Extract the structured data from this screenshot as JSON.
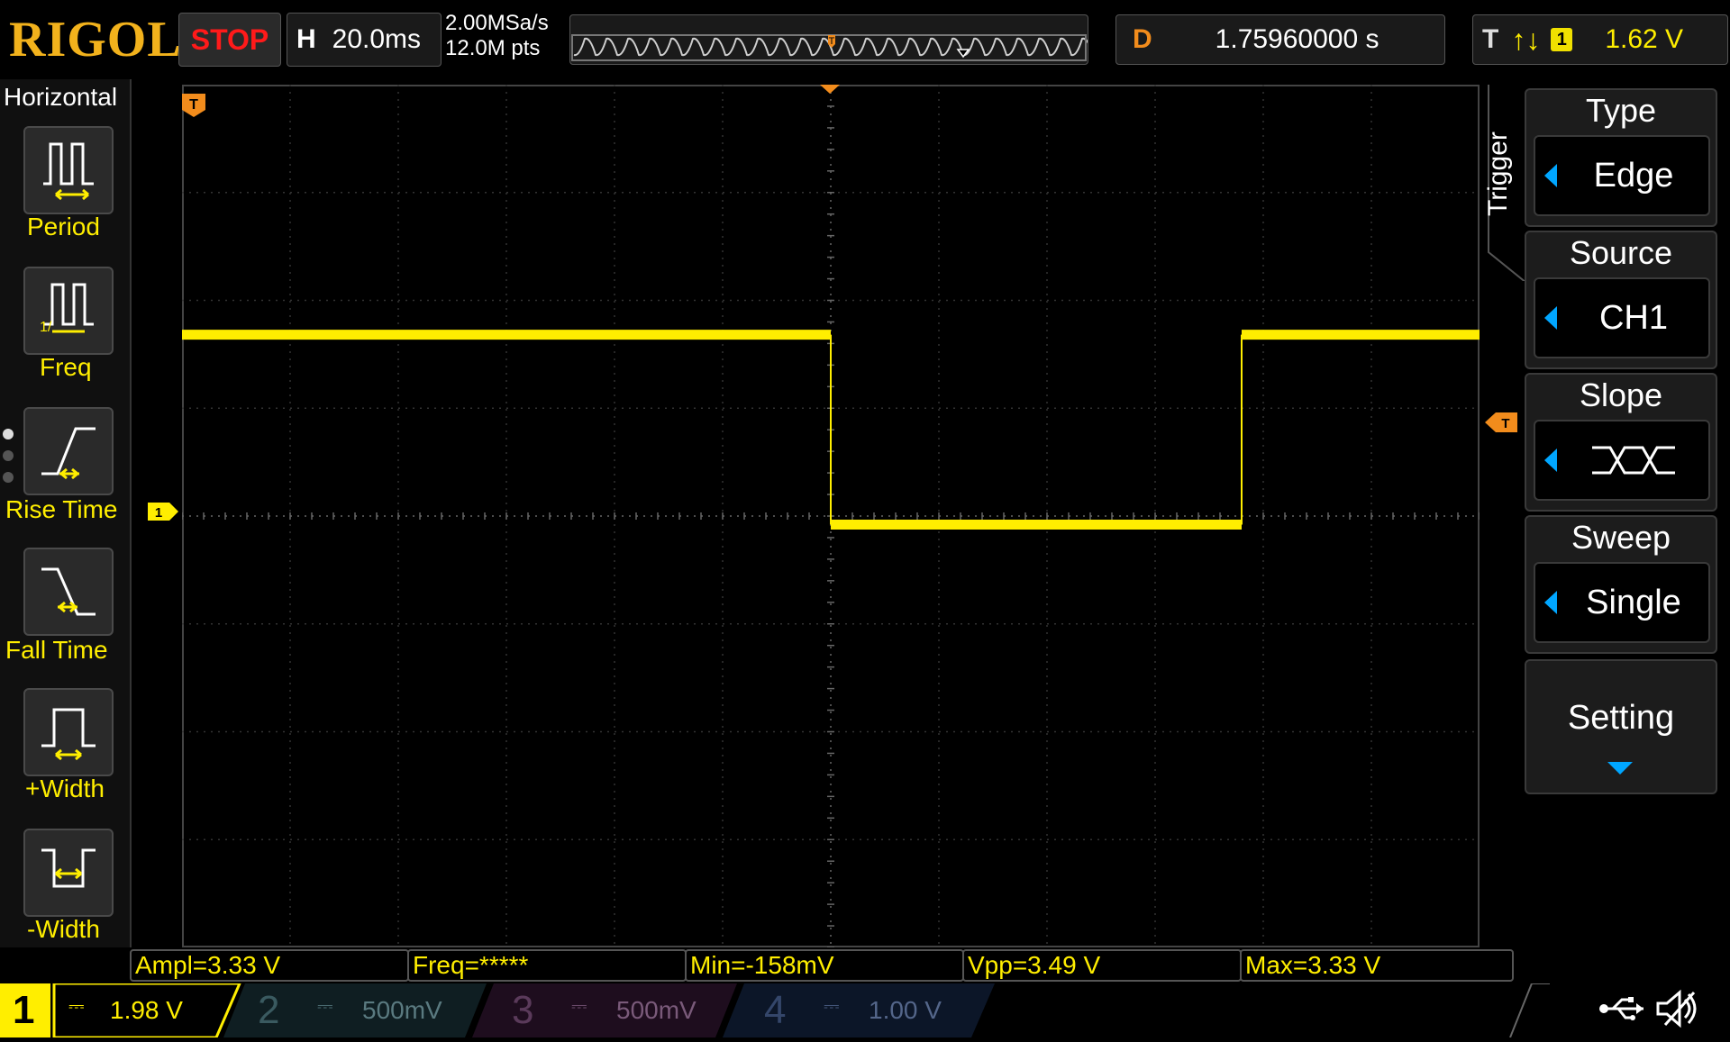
{
  "header": {
    "brand": "RIGOL",
    "run_state": "STOP",
    "timebase_letter": "H",
    "timebase_value": "20.0ms",
    "sample_rate": "2.00MSa/s",
    "memory_depth": "12.0M pts",
    "delay_letter": "D",
    "delay_value": "1.75960000 s",
    "trigger_letter": "T",
    "trigger_slope_symbol": "↑↓",
    "trigger_source": "1",
    "trigger_level": "1.62 V"
  },
  "left_menu": {
    "title": "Horizontal",
    "items": [
      {
        "label": "Period",
        "icon": "period-icon"
      },
      {
        "label": "Freq",
        "icon": "freq-icon"
      },
      {
        "label": "Rise Time",
        "icon": "rise-time-icon"
      },
      {
        "label": "Fall Time",
        "icon": "fall-time-icon"
      },
      {
        "label": "+Width",
        "icon": "positive-width-icon"
      },
      {
        "label": "-Width",
        "icon": "negative-width-icon"
      }
    ]
  },
  "right_menu": {
    "section": "Trigger",
    "items": [
      {
        "title": "Type",
        "value": "Edge"
      },
      {
        "title": "Source",
        "value": "CH1"
      },
      {
        "title": "Slope",
        "value": "either-edge-icon"
      },
      {
        "title": "Sweep",
        "value": "Single"
      }
    ],
    "setting_label": "Setting"
  },
  "measurements": [
    "Ampl=3.33 V",
    "Freq=*****",
    "Min=-158mV",
    "Vpp=3.49 V",
    "Max=3.33 V"
  ],
  "markers": {
    "channel1_marker": "1",
    "trigger_marker": "T"
  },
  "channels": [
    {
      "num": "1",
      "coupling": "⎓",
      "scale": "1.98 V",
      "color": "#ffee00",
      "active": true
    },
    {
      "num": "2",
      "coupling": "⎓",
      "scale": "500mV",
      "color": "#00b5c8",
      "active": false
    },
    {
      "num": "3",
      "coupling": "⎓",
      "scale": "500mV",
      "color": "#d020d0",
      "active": false
    },
    {
      "num": "4",
      "coupling": "⎓",
      "scale": "1.00 V",
      "color": "#1e6fd8",
      "active": false
    }
  ],
  "waveform": {
    "color": "#ffee00",
    "high_level": 3.33,
    "low_level": -0.158,
    "fall_division": 6.0,
    "rise_division": 9.8
  },
  "colors": {
    "accent_trigger": "#f28c1c",
    "menu_arrow": "#00a6ff",
    "stop": "#ff1a1a"
  }
}
